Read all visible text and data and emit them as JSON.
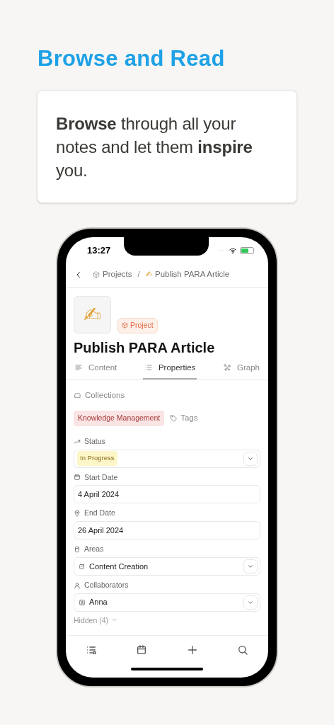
{
  "headline": "Browse and Read",
  "card": {
    "text": "**Browse** through all your notes and let them **inspire** you."
  },
  "status_bar": {
    "time": "13:27"
  },
  "breadcrumb": {
    "separator": "/",
    "items": [
      {
        "label": "Projects"
      },
      {
        "label": "Publish PARA Article",
        "emoji": "✍"
      }
    ]
  },
  "page": {
    "icon": "✍",
    "type_badge": "Project",
    "title": "Publish PARA Article"
  },
  "tabs": [
    {
      "label": "Content",
      "selected": false
    },
    {
      "label": "Properties",
      "selected": true
    },
    {
      "label": "Graph",
      "selected": false
    }
  ],
  "collections": {
    "label": "Collections",
    "tags": [
      {
        "label": "Knowledge Management"
      }
    ],
    "add_tags": "Tags"
  },
  "properties": [
    {
      "label": "Status",
      "kind": "badge",
      "value": "In Progress",
      "dropdown": true
    },
    {
      "label": "Start Date",
      "kind": "text",
      "value": "4 April 2024",
      "dropdown": false
    },
    {
      "label": "End Date",
      "kind": "text",
      "value": "26 April 2024",
      "dropdown": false
    },
    {
      "label": "Areas",
      "kind": "link",
      "value": "Content Creation",
      "dropdown": true
    },
    {
      "label": "Collaborators",
      "kind": "person",
      "value": "Anna",
      "dropdown": true
    }
  ],
  "hidden": "Hidden (4)"
}
